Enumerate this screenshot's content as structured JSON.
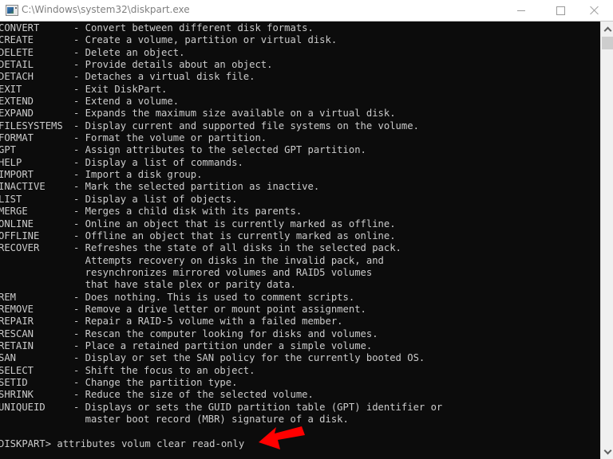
{
  "window": {
    "title": "C:\\Windows\\system32\\diskpart.exe",
    "icon": "console-app-icon",
    "controls": {
      "minimize": "minimize-icon",
      "maximize": "maximize-icon",
      "close": "close-icon"
    }
  },
  "console": {
    "text_color": "#cccccc",
    "background": "#0c0c0c",
    "commands": [
      {
        "cmd": "CONVERT",
        "desc": [
          "- Convert between different disk formats."
        ]
      },
      {
        "cmd": "CREATE",
        "desc": [
          "- Create a volume, partition or virtual disk."
        ]
      },
      {
        "cmd": "DELETE",
        "desc": [
          "- Delete an object."
        ]
      },
      {
        "cmd": "DETAIL",
        "desc": [
          "- Provide details about an object."
        ]
      },
      {
        "cmd": "DETACH",
        "desc": [
          "- Detaches a virtual disk file."
        ]
      },
      {
        "cmd": "EXIT",
        "desc": [
          "- Exit DiskPart."
        ]
      },
      {
        "cmd": "EXTEND",
        "desc": [
          "- Extend a volume."
        ]
      },
      {
        "cmd": "EXPAND",
        "desc": [
          "- Expands the maximum size available on a virtual disk."
        ]
      },
      {
        "cmd": "FILESYSTEMS",
        "desc": [
          "- Display current and supported file systems on the volume."
        ]
      },
      {
        "cmd": "FORMAT",
        "desc": [
          "- Format the volume or partition."
        ]
      },
      {
        "cmd": "GPT",
        "desc": [
          "- Assign attributes to the selected GPT partition."
        ]
      },
      {
        "cmd": "HELP",
        "desc": [
          "- Display a list of commands."
        ]
      },
      {
        "cmd": "IMPORT",
        "desc": [
          "- Import a disk group."
        ]
      },
      {
        "cmd": "INACTIVE",
        "desc": [
          "- Mark the selected partition as inactive."
        ]
      },
      {
        "cmd": "LIST",
        "desc": [
          "- Display a list of objects."
        ]
      },
      {
        "cmd": "MERGE",
        "desc": [
          "- Merges a child disk with its parents."
        ]
      },
      {
        "cmd": "ONLINE",
        "desc": [
          "- Online an object that is currently marked as offline."
        ]
      },
      {
        "cmd": "OFFLINE",
        "desc": [
          "- Offline an object that is currently marked as online."
        ]
      },
      {
        "cmd": "RECOVER",
        "desc": [
          "- Refreshes the state of all disks in the selected pack.",
          "  Attempts recovery on disks in the invalid pack, and",
          "  resynchronizes mirrored volumes and RAID5 volumes",
          "  that have stale plex or parity data."
        ]
      },
      {
        "cmd": "REM",
        "desc": [
          "- Does nothing. This is used to comment scripts."
        ]
      },
      {
        "cmd": "REMOVE",
        "desc": [
          "- Remove a drive letter or mount point assignment."
        ]
      },
      {
        "cmd": "REPAIR",
        "desc": [
          "- Repair a RAID-5 volume with a failed member."
        ]
      },
      {
        "cmd": "RESCAN",
        "desc": [
          "- Rescan the computer looking for disks and volumes."
        ]
      },
      {
        "cmd": "RETAIN",
        "desc": [
          "- Place a retained partition under a simple volume."
        ]
      },
      {
        "cmd": "SAN",
        "desc": [
          "- Display or set the SAN policy for the currently booted OS."
        ]
      },
      {
        "cmd": "SELECT",
        "desc": [
          "- Shift the focus to an object."
        ]
      },
      {
        "cmd": "SETID",
        "desc": [
          "- Change the partition type."
        ]
      },
      {
        "cmd": "SHRINK",
        "desc": [
          "- Reduce the size of the selected volume."
        ]
      },
      {
        "cmd": "UNIQUEID",
        "desc": [
          "- Displays or sets the GUID partition table (GPT) identifier or",
          "  master boot record (MBR) signature of a disk."
        ]
      }
    ],
    "prompt": "DISKPART> ",
    "input": "attributes volum clear read-only"
  },
  "annotation": {
    "type": "arrow",
    "color": "#ff0000",
    "points_to": "prompt-input"
  },
  "scrollbar": {
    "up": "chevron-up-icon",
    "down": "chevron-down-icon"
  }
}
